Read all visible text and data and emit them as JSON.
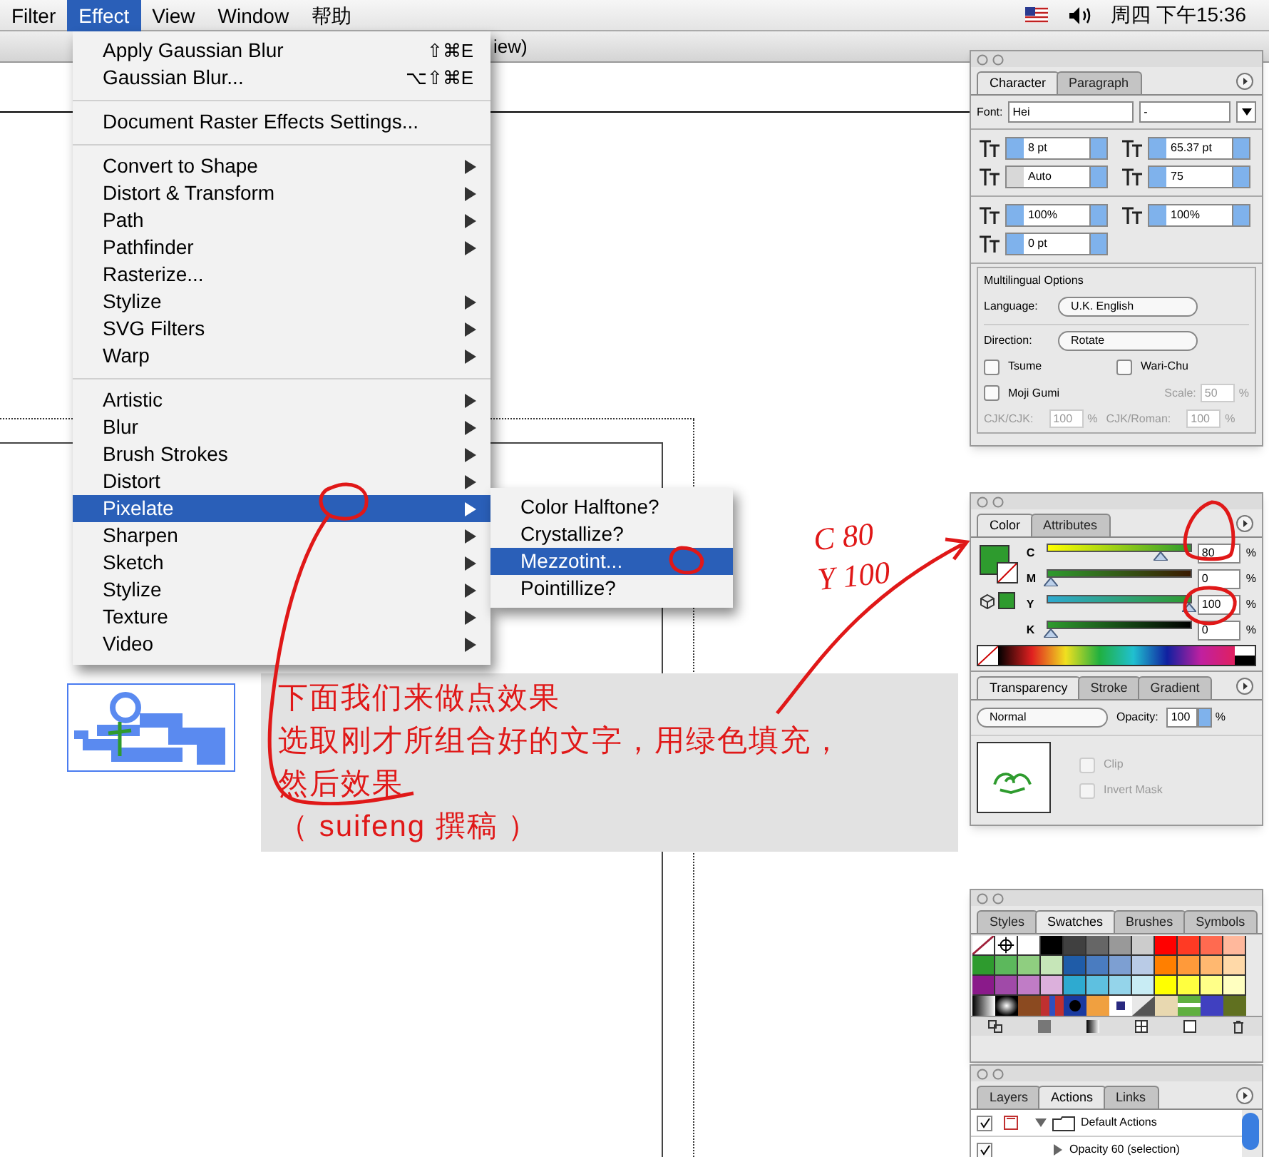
{
  "menu_bar": {
    "items": [
      {
        "label": "Filter",
        "selected": false
      },
      {
        "label": "Effect",
        "selected": true
      },
      {
        "label": "View",
        "selected": false
      },
      {
        "label": "Window",
        "selected": false
      },
      {
        "label": "帮助",
        "selected": false
      }
    ],
    "clock": "周四 下午15:36"
  },
  "document": {
    "title": "iew)"
  },
  "effect_menu": {
    "sections": [
      [
        {
          "label": "Apply Gaussian Blur",
          "shortcut": "⇧⌘E",
          "submenu": false,
          "selected": false
        },
        {
          "label": "Gaussian Blur...",
          "shortcut": "⌥⇧⌘E",
          "submenu": false,
          "selected": false
        }
      ],
      [
        {
          "label": "Document Raster Effects Settings...",
          "submenu": false,
          "selected": false
        }
      ],
      [
        {
          "label": "Convert to Shape",
          "submenu": true,
          "selected": false
        },
        {
          "label": "Distort & Transform",
          "submenu": true,
          "selected": false
        },
        {
          "label": "Path",
          "submenu": true,
          "selected": false
        },
        {
          "label": "Pathfinder",
          "submenu": true,
          "selected": false
        },
        {
          "label": "Rasterize...",
          "submenu": false,
          "selected": false
        },
        {
          "label": "Stylize",
          "submenu": true,
          "selected": false
        },
        {
          "label": "SVG Filters",
          "submenu": true,
          "selected": false
        },
        {
          "label": "Warp",
          "submenu": true,
          "selected": false
        }
      ],
      [
        {
          "label": "Artistic",
          "submenu": true,
          "selected": false
        },
        {
          "label": "Blur",
          "submenu": true,
          "selected": false
        },
        {
          "label": "Brush Strokes",
          "submenu": true,
          "selected": false
        },
        {
          "label": "Distort",
          "submenu": true,
          "selected": false
        },
        {
          "label": "Pixelate",
          "submenu": true,
          "selected": true
        },
        {
          "label": "Sharpen",
          "submenu": true,
          "selected": false
        },
        {
          "label": "Sketch",
          "submenu": true,
          "selected": false
        },
        {
          "label": "Stylize",
          "submenu": true,
          "selected": false
        },
        {
          "label": "Texture",
          "submenu": true,
          "selected": false
        },
        {
          "label": "Video",
          "submenu": true,
          "selected": false
        }
      ]
    ]
  },
  "pixelate_submenu": {
    "items": [
      {
        "label": "Color Halftone?",
        "selected": false
      },
      {
        "label": "Crystallize?",
        "selected": false
      },
      {
        "label": "Mezzotint...",
        "selected": true
      },
      {
        "label": "Pointillize?",
        "selected": false
      }
    ]
  },
  "annotation": {
    "lines": [
      "下面我们来做点效果",
      "选取刚才所组合好的文字，用绿色填充，",
      "然后效果",
      "（ suifeng 撰稿 ）"
    ],
    "handwriting": [
      "C 80",
      "Y 100"
    ]
  },
  "character_panel": {
    "tabs": [
      {
        "label": "Character",
        "selected": true
      },
      {
        "label": "Paragraph",
        "selected": false
      }
    ],
    "font_label": "Font:",
    "font": "Hei",
    "font_style": "-",
    "fields": [
      {
        "value": "8 pt",
        "disabled": false
      },
      {
        "value": "65.37 pt",
        "disabled": false
      },
      {
        "value": "Auto",
        "disabled": true
      },
      {
        "value": "75",
        "disabled": false
      },
      {
        "value": "100%",
        "disabled": false
      },
      {
        "value": "100%",
        "disabled": false
      },
      {
        "value": "0 pt",
        "disabled": false
      }
    ],
    "multilingual": {
      "title": "Multilingual Options",
      "language_label": "Language:",
      "language": "U.K. English",
      "direction_label": "Direction:",
      "direction": "Rotate",
      "checkboxes": [
        {
          "label": "Tsume",
          "checked": false
        },
        {
          "label": "Wari-Chu",
          "checked": false
        },
        {
          "label": "Moji Gumi",
          "checked": false
        }
      ],
      "scale": {
        "label": "Scale:",
        "value": "50",
        "unit": "%"
      },
      "cjk_cjk": {
        "label": "CJK/CJK:",
        "value": "100",
        "unit": "%"
      },
      "cjk_roman": {
        "label": "CJK/Roman:",
        "value": "100",
        "unit": "%"
      }
    }
  },
  "color_panel": {
    "tabs": [
      {
        "label": "Color",
        "selected": true
      },
      {
        "label": "Attributes",
        "selected": false
      }
    ],
    "channels": [
      {
        "label": "C",
        "level": 0.8,
        "value": "80",
        "unit": "%"
      },
      {
        "label": "M",
        "level": 0,
        "value": "0",
        "unit": "%"
      },
      {
        "label": "Y",
        "level": 1,
        "value": "100",
        "unit": "%"
      },
      {
        "label": "K",
        "level": 0,
        "value": "0",
        "unit": "%"
      }
    ]
  },
  "transparency_panel": {
    "tabs": [
      {
        "label": "Transparency",
        "selected": true
      },
      {
        "label": "Stroke",
        "selected": false
      },
      {
        "label": "Gradient",
        "selected": false
      }
    ],
    "mode": "Normal",
    "opacity_label": "Opacity:",
    "opacity": "100",
    "unit": "%",
    "checkboxes": [
      {
        "label": "Clip",
        "checked": false,
        "disabled": true
      },
      {
        "label": "Invert Mask",
        "checked": false,
        "disabled": true
      }
    ]
  },
  "swatches_panel": {
    "tabs": [
      {
        "label": "Styles",
        "selected": false
      },
      {
        "label": "Swatches",
        "selected": true
      },
      {
        "label": "Brushes",
        "selected": false
      },
      {
        "label": "Symbols",
        "selected": false
      }
    ],
    "swatches": [
      {
        "kind": "none"
      },
      {
        "kind": "registration"
      },
      {
        "kind": "color",
        "color": "#ffffff"
      },
      {
        "kind": "color",
        "color": "#000000"
      },
      {
        "kind": "color",
        "color": "#404040"
      },
      {
        "kind": "color",
        "color": "#666666"
      },
      {
        "kind": "color",
        "color": "#999999"
      },
      {
        "kind": "color",
        "color": "#cccccc"
      },
      {
        "kind": "color",
        "color": "#ff0000"
      },
      {
        "kind": "color",
        "color": "#ff3a24"
      },
      {
        "kind": "color",
        "color": "#ff6a50"
      },
      {
        "kind": "color",
        "color": "#ffb89c"
      },
      {
        "kind": "color",
        "color": "#2e9b2e"
      },
      {
        "kind": "color",
        "color": "#5cb85c"
      },
      {
        "kind": "color",
        "color": "#8fce80"
      },
      {
        "kind": "color",
        "color": "#c6e6b8"
      },
      {
        "kind": "color",
        "color": "#1f5ca8"
      },
      {
        "kind": "color",
        "color": "#4a7cc0"
      },
      {
        "kind": "color",
        "color": "#7d9fd2"
      },
      {
        "kind": "color",
        "color": "#b9cbe6"
      },
      {
        "kind": "color",
        "color": "#ff7f00"
      },
      {
        "kind": "color",
        "color": "#ff9a3a"
      },
      {
        "kind": "color",
        "color": "#ffb870"
      },
      {
        "kind": "color",
        "color": "#ffd9a8"
      },
      {
        "kind": "color",
        "color": "#8a1a8a"
      },
      {
        "kind": "color",
        "color": "#a04aa8"
      },
      {
        "kind": "color",
        "color": "#c07cc6"
      },
      {
        "kind": "color",
        "color": "#dcb0dc"
      },
      {
        "kind": "color",
        "color": "#2eaad0"
      },
      {
        "kind": "color",
        "color": "#5ec0e0"
      },
      {
        "kind": "color",
        "color": "#94d4ea"
      },
      {
        "kind": "color",
        "color": "#c8ecf4"
      },
      {
        "kind": "color",
        "color": "#ffff00"
      },
      {
        "kind": "color",
        "color": "#ffff40"
      },
      {
        "kind": "color",
        "color": "#ffff88"
      },
      {
        "kind": "color",
        "color": "#ffffc0"
      }
    ]
  },
  "actions_panel": {
    "tabs": [
      {
        "label": "Layers",
        "selected": false
      },
      {
        "label": "Actions",
        "selected": true
      },
      {
        "label": "Links",
        "selected": false
      }
    ],
    "actions": [
      {
        "label": "Default Actions",
        "kind": "set",
        "expanded": true,
        "checked": true
      },
      {
        "label": "Opacity 60 (selection)",
        "kind": "action",
        "expanded": false,
        "checked": true
      }
    ]
  }
}
